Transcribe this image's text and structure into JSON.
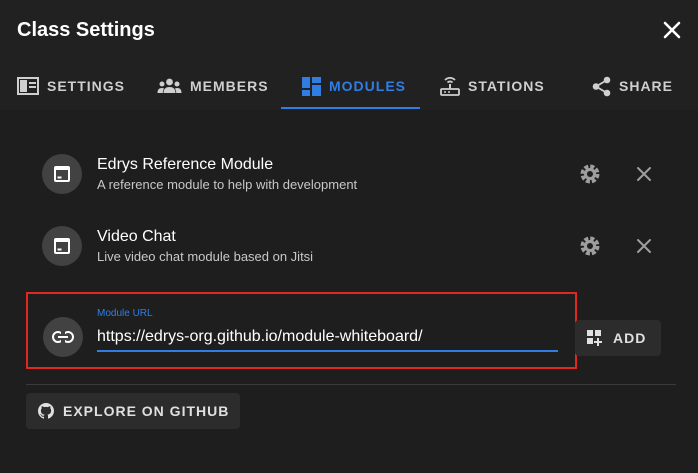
{
  "dialog": {
    "title": "Class Settings"
  },
  "tabs": [
    {
      "label": "SETTINGS",
      "icon": "settings-panel-icon",
      "active": false
    },
    {
      "label": "MEMBERS",
      "icon": "members-icon",
      "active": false
    },
    {
      "label": "MODULES",
      "icon": "modules-icon",
      "active": true
    },
    {
      "label": "STATIONS",
      "icon": "stations-icon",
      "active": false
    },
    {
      "label": "SHARE",
      "icon": "share-icon",
      "active": false
    }
  ],
  "modules": [
    {
      "title": "Edrys Reference Module",
      "subtitle": "A reference module to help with development",
      "icon": "module-icon"
    },
    {
      "title": "Video Chat",
      "subtitle": "Live video chat module based on Jitsi",
      "icon": "module-icon"
    }
  ],
  "url_field": {
    "label": "Module URL",
    "value": "https://edrys-org.github.io/module-whiteboard/",
    "icon": "link-icon"
  },
  "add_button": {
    "label": "ADD",
    "icon": "add-module-icon"
  },
  "github_button": {
    "label": "EXPLORE ON GITHUB",
    "icon": "github-icon"
  },
  "colors": {
    "accent": "#2f7ee6",
    "highlight_border": "#e0281e",
    "background": "#1e1e1e",
    "avatar": "#424242"
  }
}
